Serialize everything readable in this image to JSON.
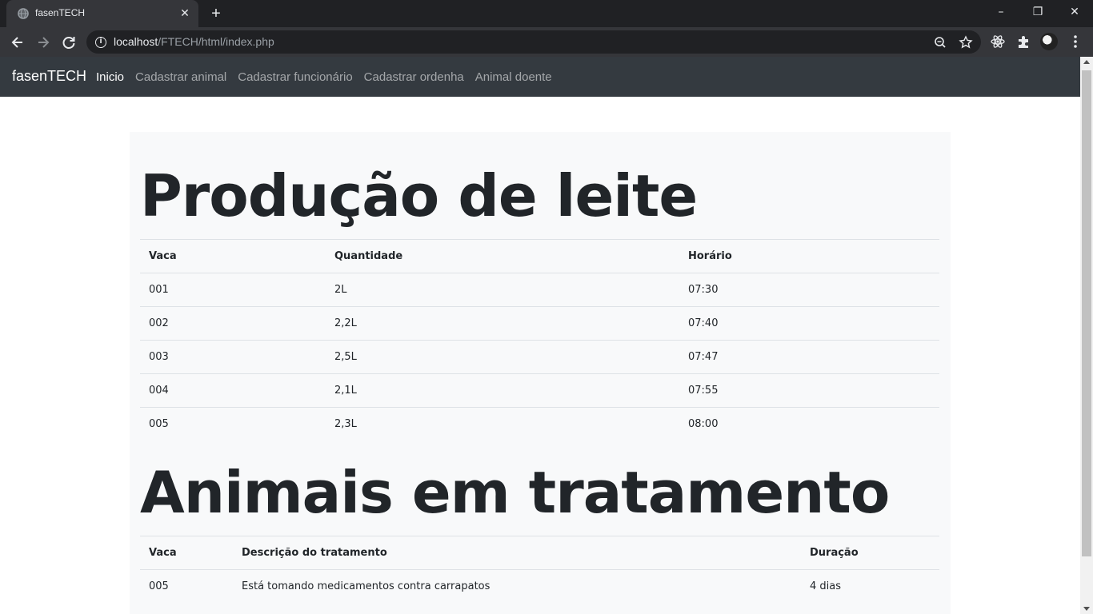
{
  "browser": {
    "tab_title": "fasenTECH",
    "tab_close": "✕",
    "new_tab": "+",
    "url_host": "localhost",
    "url_path": "/FTECH/html/index.php",
    "window_controls": {
      "minimize": "–",
      "restore": "❐",
      "close": "✕"
    }
  },
  "app": {
    "brand": "fasenTECH",
    "nav": [
      {
        "label": "Inicio",
        "active": true
      },
      {
        "label": "Cadastrar animal",
        "active": false
      },
      {
        "label": "Cadastrar funcionário",
        "active": false
      },
      {
        "label": "Cadastrar ordenha",
        "active": false
      },
      {
        "label": "Animal doente",
        "active": false
      }
    ]
  },
  "milk": {
    "title": "Produção de leite",
    "headers": [
      "Vaca",
      "Quantidade",
      "Horário"
    ],
    "rows": [
      [
        "001",
        "2L",
        "07:30"
      ],
      [
        "002",
        "2,2L",
        "07:40"
      ],
      [
        "003",
        "2,5L",
        "07:47"
      ],
      [
        "004",
        "2,1L",
        "07:55"
      ],
      [
        "005",
        "2,3L",
        "08:00"
      ]
    ]
  },
  "treatment": {
    "title": "Animais em tratamento",
    "headers": [
      "Vaca",
      "Descrição do tratamento",
      "Duração"
    ],
    "rows": [
      [
        "005",
        "Está tomando medicamentos contra carrapatos",
        "4 dias"
      ]
    ]
  }
}
